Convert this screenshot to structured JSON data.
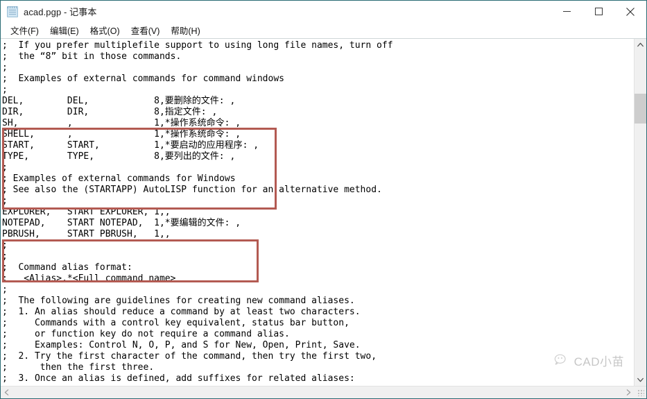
{
  "window": {
    "title": "acad.pgp - 记事本",
    "icon": "notepad-icon",
    "border_color": "#2a6b74",
    "controls": {
      "minimize": "最小化",
      "maximize": "最大化",
      "close": "关闭"
    }
  },
  "menubar": {
    "items": [
      {
        "label": "文件(F)"
      },
      {
        "label": "编辑(E)"
      },
      {
        "label": "格式(O)"
      },
      {
        "label": "查看(V)"
      },
      {
        "label": "帮助(H)"
      }
    ]
  },
  "editor": {
    "font": "monospace",
    "lines": [
      ";  If you prefer multiplefile support to using long file names, turn off",
      ";  the “8” bit in those commands.",
      ";",
      ";  Examples of external commands for command windows",
      ";",
      "DEL,        DEL,            8,要删除的文件: ,",
      "DIR,        DIR,            8,指定文件: ,",
      "SH,         ,               1,*操作系统命令: ,",
      "SHELL,      ,               1,*操作系统命令: ,",
      "START,      START,          1,*要启动的应用程序: ,",
      "TYPE,       TYPE,           8,要列出的文件: ,",
      ";",
      "; Examples of external commands for Windows",
      "; See also the (STARTAPP) AutoLISP function for an alternative method.",
      ";",
      "EXPLORER,   START EXPLORER, 1,,",
      "NOTEPAD,    START NOTEPAD,  1,*要编辑的文件: ,",
      "PBRUSH,     START PBRUSH,   1,,",
      ";",
      ";",
      ";  Command alias format:",
      ";   <Alias>,*<Full command name>",
      ";",
      ";  The following are guidelines for creating new command aliases.",
      ";  1. An alias should reduce a command by at least two characters.",
      ";     Commands with a control key equivalent, status bar button,",
      ";     or function key do not require a command alias.",
      ";     Examples: Control N, O, P, and S for New, Open, Print, Save.",
      ";  2. Try the first character of the command, then try the first two,",
      ";      then the first three.",
      ";  3. Once an alias is defined, add suffixes for related aliases:"
    ]
  },
  "annotations": {
    "color": "#b35a52",
    "boxes": [
      {
        "name": "external-commands-box",
        "lines": [
          "DEL,        DEL,            8,要删除的文件: ,",
          "DIR,        DIR,            8,指定文件: ,",
          "SH,         ,               1,*操作系统命令: ,",
          "SHELL,      ,               1,*操作系统命令: ,",
          "START,      START,          1,*要启动的应用程序: ,",
          "TYPE,       TYPE,           8,要列出的文件: ,"
        ]
      },
      {
        "name": "windows-commands-box",
        "lines": [
          "EXPLORER,   START EXPLORER, 1,,",
          "NOTEPAD,    START NOTEPAD,  1,*要编辑的文件: ,",
          "PBRUSH,     START PBRUSH,   1,,"
        ]
      }
    ]
  },
  "watermark": {
    "text": "CAD小苗",
    "icon": "wechat-logo-icon"
  },
  "scrollbars": {
    "vertical": {
      "up_arrow": "▲",
      "down_arrow": "▼"
    },
    "horizontal": {
      "left_arrow": "◀",
      "right_arrow": "▶"
    }
  }
}
